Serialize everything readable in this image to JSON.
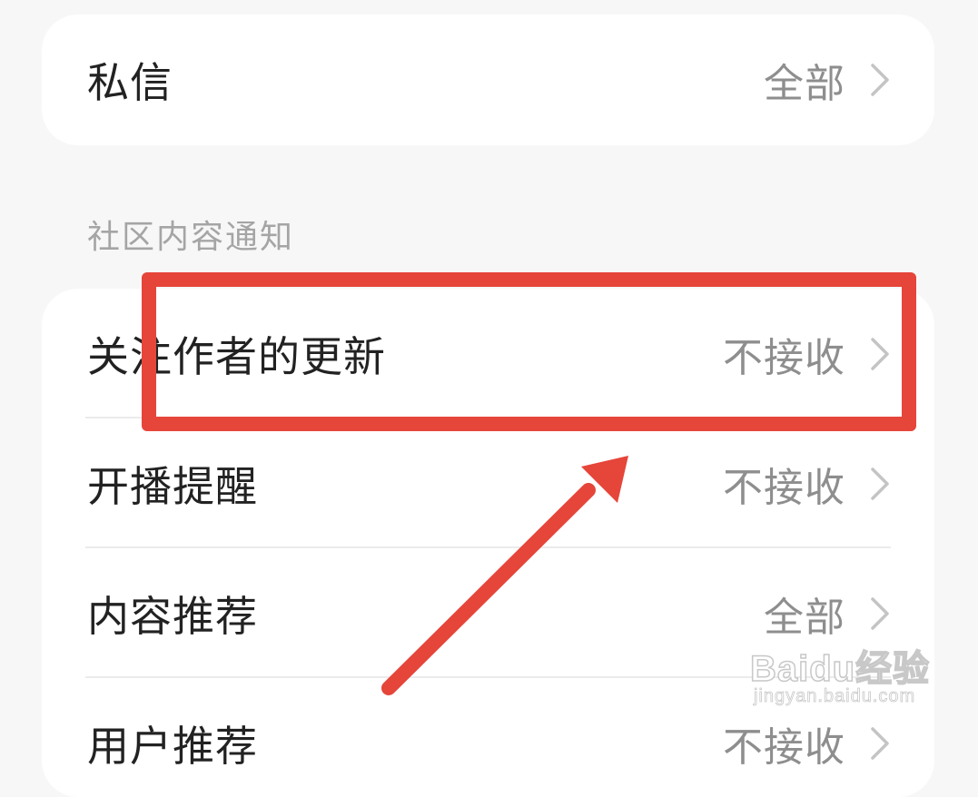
{
  "top_card": {
    "private_message": {
      "label": "私信",
      "value": "全部"
    }
  },
  "community_section": {
    "title": "社区内容通知",
    "items": [
      {
        "label": "关注作者的更新",
        "value": "不接收"
      },
      {
        "label": "开播提醒",
        "value": "不接收"
      },
      {
        "label": "内容推荐",
        "value": "全部"
      },
      {
        "label": "用户推荐",
        "value": "不接收"
      }
    ]
  },
  "annotation": {
    "color": "#e6453a"
  },
  "watermark": {
    "logo_text": "Baidu经验",
    "url_text": "jingyan.baidu.com"
  }
}
